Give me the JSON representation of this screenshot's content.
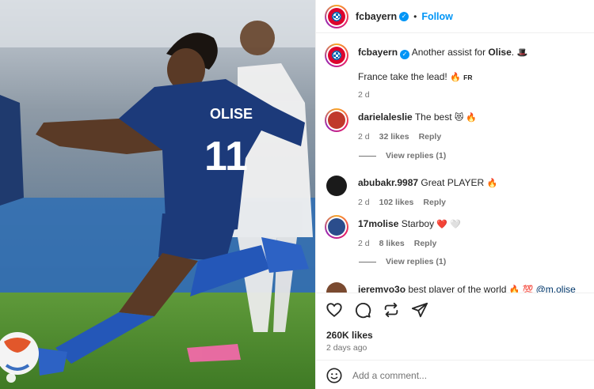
{
  "post": {
    "username": "fcbayern",
    "follow_label": "Follow",
    "separator": "•",
    "caption_text": "Another assist for",
    "caption_bold": "Olise",
    "caption_line2": "France take the lead!",
    "caption_emoji1": "🎩",
    "caption_emoji2": "🔥",
    "caption_flag": "FR",
    "caption_time": "2 d",
    "likes": "260K likes",
    "time_ago": "2 days ago",
    "comment_placeholder": "Add a comment..."
  },
  "photo": {
    "jersey_name": "OLISE",
    "jersey_number": "11"
  },
  "comments": [
    {
      "user": "darielaleslie",
      "text": "The best",
      "emoji": "😻 🔥",
      "time": "2 d",
      "likes": "32 likes",
      "reply": "Reply",
      "view_replies": "View replies (1)",
      "avatar_color": "#c0392b"
    },
    {
      "user": "abubakr.9987",
      "text": "Great PLAYER",
      "emoji": "🔥",
      "time": "2 d",
      "likes": "102 likes",
      "reply": "Reply",
      "avatar_color": "#1a1a1a"
    },
    {
      "user": "17molise",
      "text": "Starboy",
      "emoji": "❤️ 🤍",
      "time": "2 d",
      "likes": "8 likes",
      "reply": "Reply",
      "view_replies": "View replies (1)",
      "avatar_color": "#2b4d8c"
    },
    {
      "user": "jeremyo3o",
      "text": "best player of the world",
      "emoji": "🔥 💯",
      "mention": "@m.olise",
      "avatar_color": "#7a4a30"
    }
  ],
  "icons": [
    "heart-icon",
    "comment-icon",
    "repost-icon",
    "share-icon",
    "emoji-icon"
  ]
}
